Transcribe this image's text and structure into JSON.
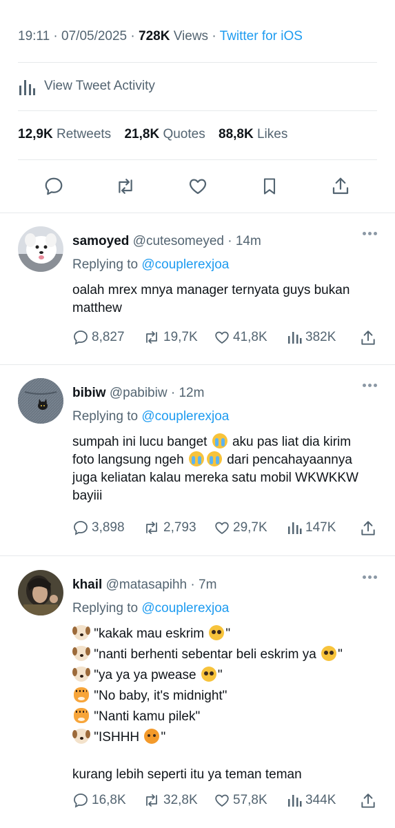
{
  "tweet": {
    "time": "19:11",
    "date": "07/05/2025",
    "views_count": "728K",
    "views_label": "Views",
    "source": "Twitter for iOS",
    "activity_label": "View Tweet Activity",
    "retweets_count": "12,9K",
    "retweets_label": "Retweets",
    "quotes_count": "21,8K",
    "quotes_label": "Quotes",
    "likes_count": "88,8K",
    "likes_label": "Likes"
  },
  "replies": [
    {
      "name": "samoyed",
      "handle": "@cutesomeyed",
      "time": "14m",
      "replying_label": "Replying to",
      "replying_to": "@couplerexjoa",
      "lines": [
        "oalah mrex mnya manager ternyata guys bukan",
        "matthew"
      ],
      "stats": {
        "replies": "8,827",
        "retweets": "19,7K",
        "likes": "41,8K",
        "views": "382K"
      }
    },
    {
      "name": "bibiw",
      "handle": "@pabibiw",
      "time": "12m",
      "replying_label": "Replying to",
      "replying_to": "@couplerexjoa",
      "line1a": "sumpah ini lucu banget",
      "line1b": "aku pas liat dia kirim",
      "line2a": "foto langsung ngeh",
      "line2b": "dari pencahayaannya",
      "line3": "juga keliatan kalau mereka satu mobil WKWKKW",
      "line4": "bayiii",
      "stats": {
        "replies": "3,898",
        "retweets": "2,793",
        "likes": "29,7K",
        "views": "147K"
      }
    },
    {
      "name": "khail",
      "handle": "@matasapihh",
      "time": "7m",
      "replying_label": "Replying to",
      "replying_to": "@couplerexjoa",
      "l1": "\"kakak mau eskrim",
      "l1e": "\"",
      "l2": "\"nanti berhenti sebentar beli eskrim ya",
      "l2e": "\"",
      "l3": "\"ya ya ya pwease",
      "l3e": "\"",
      "l4": "\"No baby, it's midnight\"",
      "l5": "\"Nanti kamu pilek\"",
      "l6": "\"ISHHH",
      "l6e": "\"",
      "closing": "kurang lebih seperti itu ya teman teman",
      "stats": {
        "replies": "16,8K",
        "retweets": "32,8K",
        "likes": "57,8K",
        "views": "344K"
      }
    }
  ],
  "colors": {
    "link": "#1d9bf0",
    "muted": "#536471",
    "text": "#0f1419",
    "divider": "#e6e9eb"
  },
  "icons": [
    "reply-icon",
    "retweet-icon",
    "like-icon",
    "bookmark-icon",
    "share-icon",
    "views-icon",
    "more-icon"
  ]
}
